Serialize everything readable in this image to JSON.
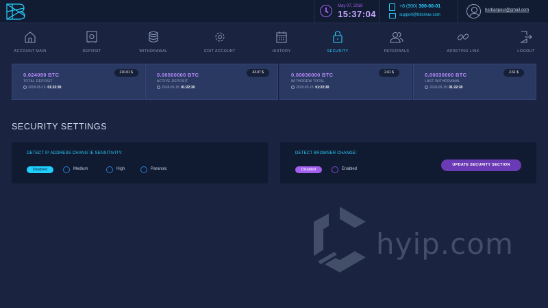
{
  "header": {
    "date": "May 07, 2018",
    "time": "15:37:04",
    "phone_prefix": "+8 (900)",
    "phone_number": "300-00-01",
    "support_email": "support@bitsmax.com",
    "user_email": "horbanpour@gmail.com"
  },
  "nav": [
    {
      "label": "ACCOUNT MAIN",
      "icon": "home-icon",
      "active": false
    },
    {
      "label": "DEPOSIT",
      "icon": "safe-icon",
      "active": false
    },
    {
      "label": "WITHDRAWAL",
      "icon": "coins-icon",
      "active": false
    },
    {
      "label": "EDIT ACCOUNT",
      "icon": "gear-icon",
      "active": false
    },
    {
      "label": "HISTORY",
      "icon": "calendar-icon",
      "active": false
    },
    {
      "label": "SECURITY",
      "icon": "lock-icon",
      "active": true
    },
    {
      "label": "REFERRALS",
      "icon": "users-icon",
      "active": false
    },
    {
      "label": "ADRETING  LINK",
      "icon": "link-icon",
      "active": false
    },
    {
      "label": "LOGOUT",
      "icon": "logout-icon",
      "active": false
    }
  ],
  "cards": [
    {
      "value": "0.024099 BTC",
      "label": "TOTAL DEPOSIT",
      "date": "2018-05-15:",
      "time": "01:22:30",
      "badge": "210.01 $"
    },
    {
      "value": "0.00500000 BTC",
      "label": "ACTIVE DEPOSIT",
      "date": "2018-05-15:",
      "time": "01:22:30",
      "badge": "43.07 $"
    },
    {
      "value": "0.00030000 BTC",
      "label": "WITHDREW TOTAL",
      "date": "2018-05-15:",
      "time": "01:22:30",
      "badge": "2.61 $"
    },
    {
      "value": "0.00030000 BTC",
      "label": "LAST WITHDRAWAL",
      "date": "2018-05-15:",
      "time": "01:22:30",
      "badge": "2.61 $"
    }
  ],
  "security": {
    "title": "SECURITY SETTINGS",
    "ip_panel": {
      "title": "DETECT IP ADDRESS CHANG`IE SENSITIVITY:",
      "selected": "Disabled",
      "options": [
        "Medium",
        "High",
        "Paranoic"
      ]
    },
    "browser_panel": {
      "title": "DETECT BROWSER CHANGE:",
      "selected": "Disabled",
      "options": [
        "Enabled"
      ]
    },
    "update_button": "UPDATE SECURITY SECTION"
  },
  "watermark": {
    "text": "hyip.com"
  },
  "colors": {
    "background": "#1a2440",
    "accent_cyan": "#2bd0ff",
    "accent_purple": "#a35ff0"
  }
}
